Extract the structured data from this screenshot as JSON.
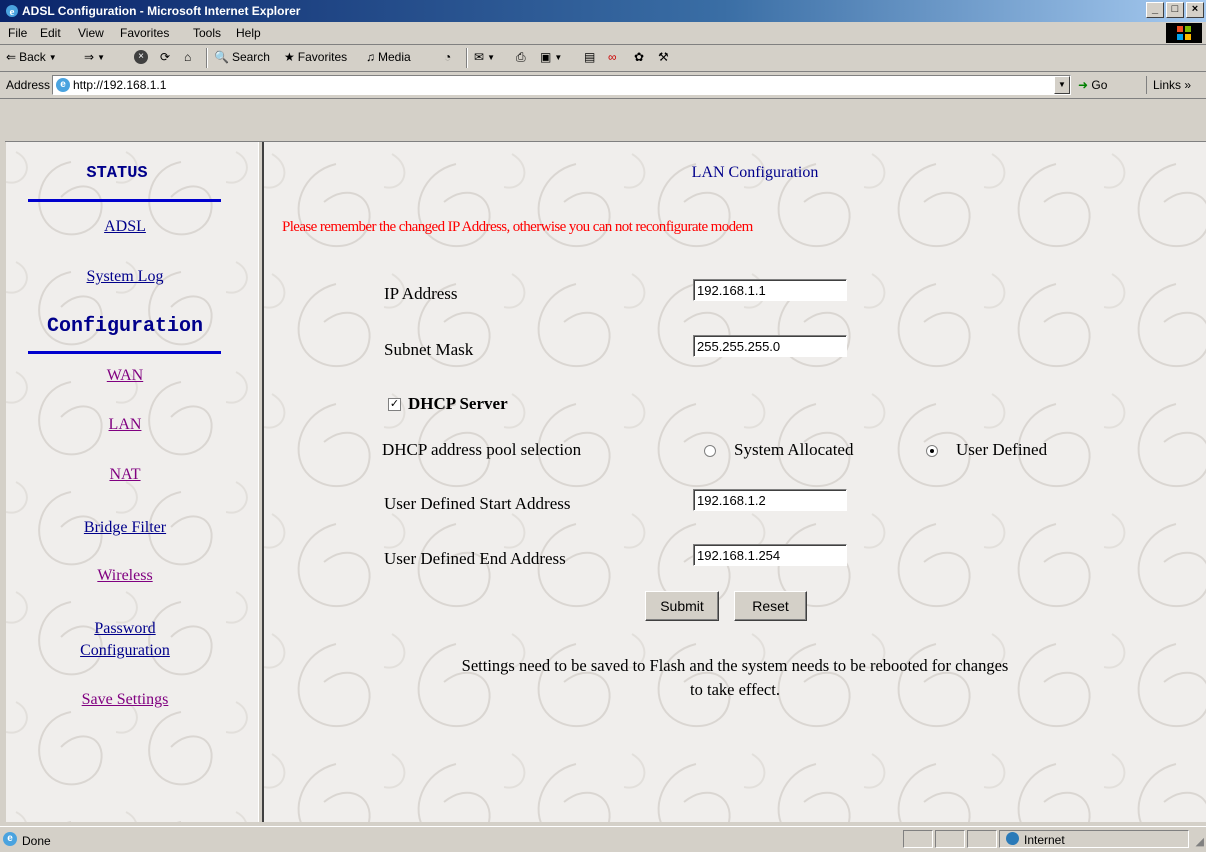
{
  "window": {
    "title": "ADSL Configuration - Microsoft Internet Explorer"
  },
  "menu": {
    "items": [
      "File",
      "Edit",
      "View",
      "Favorites",
      "Tools",
      "Help"
    ]
  },
  "toolbar": {
    "back": "Back",
    "search": "Search",
    "favorites": "Favorites",
    "media": "Media"
  },
  "address": {
    "label": "Address",
    "url": "http://192.168.1.1",
    "go": "Go",
    "links": "Links"
  },
  "sidebar": {
    "status_heading": "STATUS",
    "adsl": "ADSL",
    "system_log": "System Log",
    "config_heading": "Configuration",
    "wan": "WAN",
    "lan": "LAN",
    "nat": "NAT",
    "bridge_filter": "Bridge Filter",
    "wireless": "Wireless",
    "password_line1": "Password",
    "password_line2": "Configuration",
    "save_settings": "Save Settings"
  },
  "main": {
    "title": "LAN Configuration",
    "warning": "Please remember the changed IP Address, otherwise you can not reconfigurate modem",
    "ip_label": "IP Address",
    "ip_value": "192.168.1.1",
    "mask_label": "Subnet Mask",
    "mask_value": "255.255.255.0",
    "dhcp_label": "DHCP Server",
    "dhcp_checked": true,
    "pool_label": "DHCP address pool selection",
    "pool_option_system": "System Allocated",
    "pool_option_user": "User Defined",
    "pool_selected": "User Defined",
    "start_label": "User Defined Start Address",
    "start_value": "192.168.1.2",
    "end_label": "User Defined End Address",
    "end_value": "192.168.1.254",
    "submit": "Submit",
    "reset": "Reset",
    "footer_line1": "Settings need to be saved to Flash and the system needs to be rebooted for changes",
    "footer_line2": "to take effect."
  },
  "status": {
    "text": "Done",
    "zone": "Internet"
  },
  "colors": {
    "title_bar": "#0a246a",
    "link": "#00008b",
    "visited_link": "#800080",
    "warning": "#ff0000",
    "heading_rule": "#0000cd"
  }
}
